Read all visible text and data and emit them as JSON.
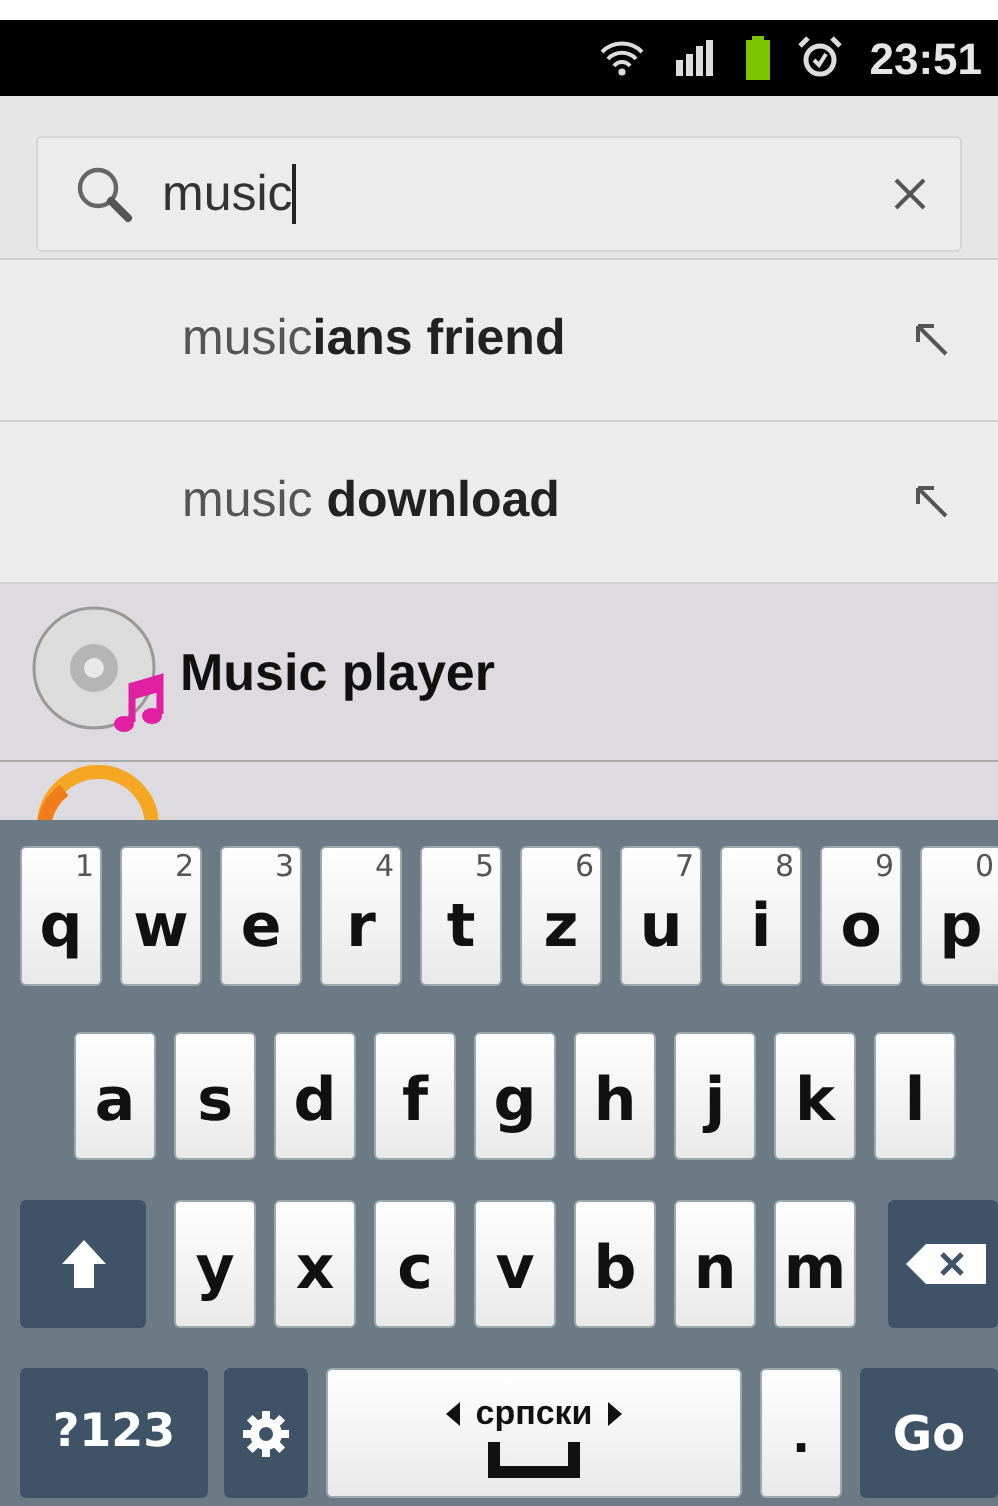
{
  "status_bar": {
    "time": "23:51"
  },
  "search": {
    "value": "music"
  },
  "suggestions": [
    {
      "text": "music**ians friend**"
    },
    {
      "text": "music **download**"
    }
  ],
  "results": [
    {
      "kind": "app",
      "title": "Music player"
    },
    {
      "kind": "app-cut"
    }
  ],
  "keyboard": {
    "rows": [
      {
        "keys": [
          {
            "kind": "letter",
            "label": "q",
            "hint": "1"
          },
          {
            "kind": "letter",
            "label": "w",
            "hint": "2"
          },
          {
            "kind": "letter",
            "label": "e",
            "hint": "3"
          },
          {
            "kind": "letter",
            "label": "r",
            "hint": "4"
          },
          {
            "kind": "letter",
            "label": "t",
            "hint": "5"
          },
          {
            "kind": "letter",
            "label": "z",
            "hint": "6"
          },
          {
            "kind": "letter",
            "label": "u",
            "hint": "7"
          },
          {
            "kind": "letter",
            "label": "i",
            "hint": "8"
          },
          {
            "kind": "letter",
            "label": "o",
            "hint": "9"
          },
          {
            "kind": "letter",
            "label": "p",
            "hint": "0"
          }
        ]
      },
      {
        "keys": [
          {
            "kind": "letter",
            "label": "a"
          },
          {
            "kind": "letter",
            "label": "s"
          },
          {
            "kind": "letter",
            "label": "d"
          },
          {
            "kind": "letter",
            "label": "f"
          },
          {
            "kind": "letter",
            "label": "g"
          },
          {
            "kind": "letter",
            "label": "h"
          },
          {
            "kind": "letter",
            "label": "j"
          },
          {
            "kind": "letter",
            "label": "k"
          },
          {
            "kind": "letter",
            "label": "l"
          }
        ]
      },
      {
        "keys": [
          {
            "kind": "shift"
          },
          {
            "kind": "letter",
            "label": "y"
          },
          {
            "kind": "letter",
            "label": "x"
          },
          {
            "kind": "letter",
            "label": "c"
          },
          {
            "kind": "letter",
            "label": "v"
          },
          {
            "kind": "letter",
            "label": "b"
          },
          {
            "kind": "letter",
            "label": "n"
          },
          {
            "kind": "letter",
            "label": "m"
          },
          {
            "kind": "delete"
          }
        ]
      },
      {
        "keys": [
          {
            "kind": "symbols",
            "label": "?123"
          },
          {
            "kind": "settings"
          },
          {
            "kind": "space",
            "label": "српски"
          },
          {
            "kind": "period",
            "label": "."
          },
          {
            "kind": "go",
            "label": "Go"
          }
        ]
      }
    ]
  }
}
